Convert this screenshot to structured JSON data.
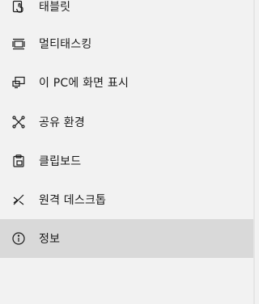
{
  "nav": {
    "items": [
      {
        "label": "태블릿",
        "icon": "tablet-icon",
        "selected": false
      },
      {
        "label": "멀티태스킹",
        "icon": "multitasking-icon",
        "selected": false
      },
      {
        "label": "이 PC에 화면 표시",
        "icon": "project-to-pc-icon",
        "selected": false
      },
      {
        "label": "공유 환경",
        "icon": "shared-experiences-icon",
        "selected": false
      },
      {
        "label": "클립보드",
        "icon": "clipboard-icon",
        "selected": false
      },
      {
        "label": "원격 데스크톱",
        "icon": "remote-desktop-icon",
        "selected": false
      },
      {
        "label": "정보",
        "icon": "info-icon",
        "selected": true
      }
    ]
  },
  "colors": {
    "background": "#f2f2f2",
    "selected_background": "#d9d9d9",
    "text": "#1a1a1a"
  }
}
